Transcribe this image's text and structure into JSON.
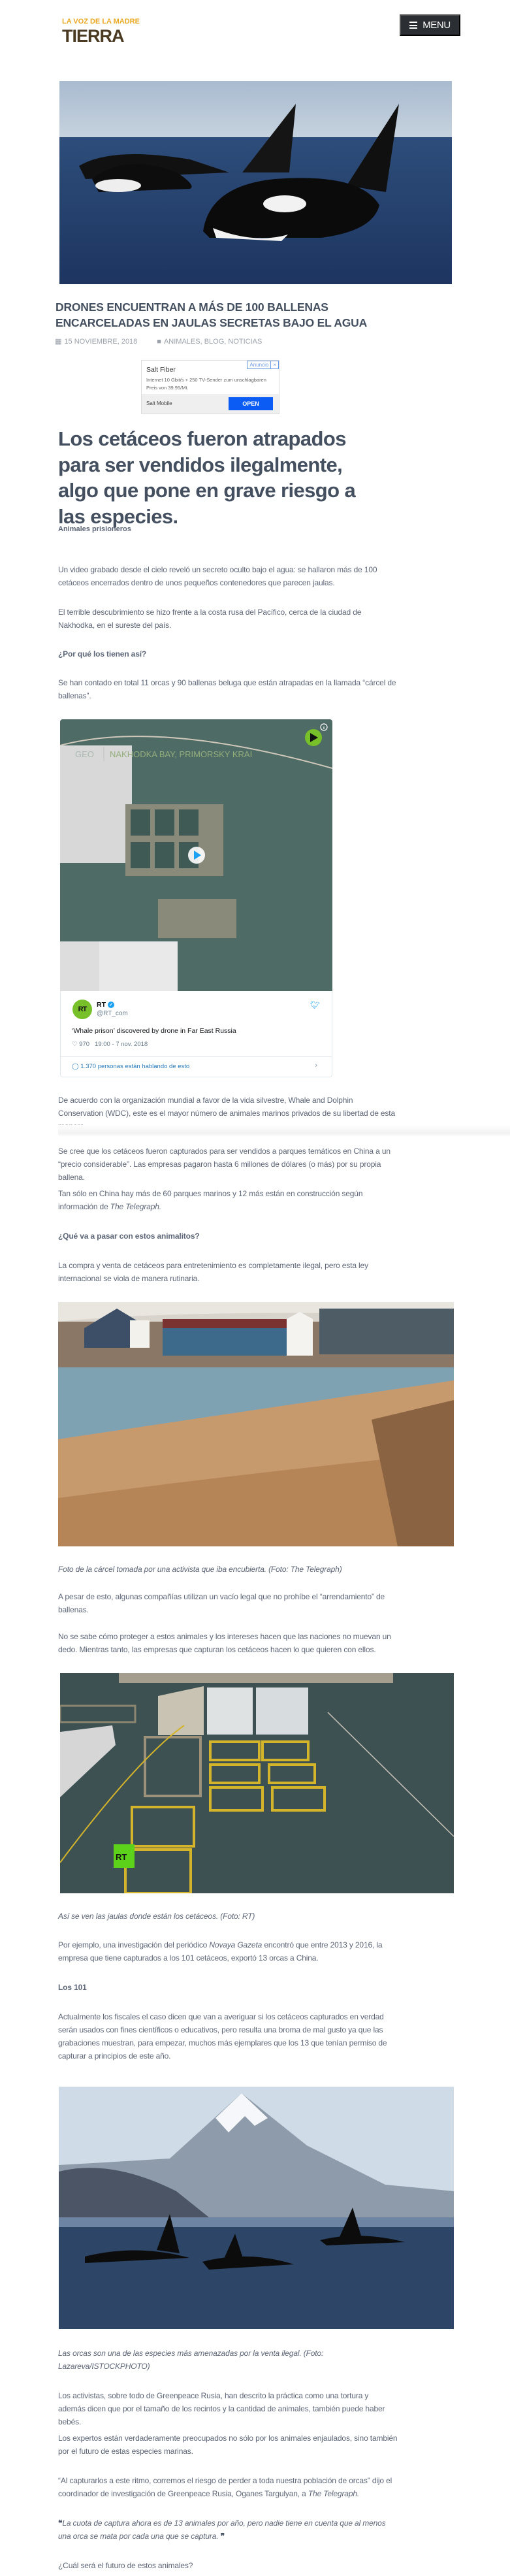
{
  "header": {
    "logo_text_top": "LA VOZ DE LA MADRE",
    "logo_text_main": "TIERRA",
    "menu_label": "MENU",
    "menu_icon": "hamburger-icon"
  },
  "colors": {
    "heading": "#444f5f",
    "body_text": "#5d6677",
    "menu_bg": "#2b2f33",
    "ad_button": "#0a5cf5",
    "twitter_blue": "#1da1f2",
    "rt_green": "#78c02a"
  },
  "article": {
    "title": "DRONES ENCUENTRAN A MÁS DE 100 BALLENAS ENCARCELADAS EN JAULAS SECRETAS BAJO EL AGUA",
    "date": "15 NOVIEMBRE, 2018",
    "categories": "ANIMALES, BLOG, NOTICIAS",
    "lead": "Los cetáceos fueron atrapados para ser vendidos ilegalmente, algo que pone en grave riesgo a las especies.",
    "kicker": "Animales prisioneros",
    "p1": "Un video grabado desde el cielo reveló un secreto oculto bajo el agua: se hallaron más de 100 cetáceos encerrados dentro de unos pequeños contenedores que parecen jaulas.",
    "p2": "El terrible descubrimiento se hizo frente a la costa rusa del Pacífico, cerca de la ciudad de Nakhodka, en el sureste del país.",
    "h1": "¿Por qué los tienen así?",
    "p3": "Se han contado en total 11 orcas y 90 ballenas beluga que están atrapadas en la llamada “cárcel de ballenas”.",
    "p4": "De acuerdo con la organización mundial a favor de la vida silvestre, Whale and Dolphin Conservation (WDC), este es el mayor número de animales marinos privados de su libertad de esta manera.",
    "p5": "Se cree que los cetáceos fueron capturados para ser vendidos a parques temáticos en China a un “precio considerable”. Las empresas pagaron hasta 6 millones de dólares (o más) por su propia ballena.",
    "p6_pre": "Tan sólo en China hay más de 60 parques marinos y 12 más están en construcción según información de ",
    "p6_em": "The Telegraph.",
    "h2": "¿Qué va a pasar con estos animalitos?",
    "p7": "La compra y venta de cetáceos para entretenimiento es completamente ilegal, pero esta ley internacional se viola de manera rutinaria.",
    "cap1": "Foto de la cárcel tomada por una activista que iba encubierta. (Foto: The Telegraph)",
    "p8": "A pesar de esto, algunas compañías utilizan un vacío legal que no prohíbe el “arrendamiento” de ballenas.",
    "p9": "No se sabe cómo proteger a estos animales y los intereses hacen que las naciones no muevan un dedo. Mientras tanto, las empresas que capturan los cetáceos hacen lo que quieren con ellos.",
    "cap2": "Así se ven las jaulas donde están los cetáceos. (Foto: RT)",
    "p10_pre": "Por ejemplo, una investigación del periódico ",
    "p10_em": "Novaya Gazeta",
    "p10_post": " encontró que entre 2013 y 2016, la empresa que tiene capturados a los 101 cetáceos, exportó 13 orcas a China.",
    "h3": "Los 101",
    "p11": "Actualmente los fiscales el caso dicen que van a averiguar si los cetáceos capturados en verdad serán usados con fines científicos o educativos, pero resulta una broma de mal gusto ya que las grabaciones muestran, para empezar, muchos más ejemplares que los 13 que tenían permiso de capturar a principios de este año.",
    "cap3": "Las orcas son una de las especies más amenazadas por la venta ilegal. (Foto: Lazareva/ISTOCKPHOTO)",
    "p12": "Los activistas, sobre todo de Greenpeace Rusia, han descrito la práctica como una tortura y además dicen que por el tamaño de los recintos y la cantidad de animales, también puede haber bebés.",
    "p13": "Los expertos están verdaderamente preocupados no sólo por los animales enjaulados, sino también por el futuro de estas especies marinas.",
    "p14_pre": "“Al capturarlos a este ritmo, corremos el riesgo de perder a toda nuestra población de orcas” dijo el coordinador de investigación de Greenpeace Rusia, Oganes Targulyan, a ",
    "p14_em": "The Telegraph.",
    "quote_open": "❝",
    "quote": "La cuota de captura ahora es de 13 animales por año, pero nadie tiene en cuenta que al menos una orca se mata por cada una que se captura.",
    "quote_close": "❞",
    "p15": "¿Cuál será el futuro de estos animales?"
  },
  "ad": {
    "tag": "Anuncio",
    "close": "×",
    "headline": "Salt Fiber",
    "description": "Internet 10 Gbit/s + 250 TV-Sender zum unschlagbaren Preis von 39.95/Mt.",
    "advertiser": "Salt Mobile",
    "cta": "OPEN"
  },
  "tweet": {
    "video_overlay_geo": "GEO",
    "video_overlay_place": "NAKHODKA BAY, PRIMORSKY KRAI",
    "avatar_text": "RT",
    "name": "RT",
    "handle": "@RT_com",
    "text": "‘Whale prison’ discovered by drone in Far East Russia",
    "likes": "970",
    "timestamp": "19:00 - 7 nov. 2018",
    "talking": "1.370 personas están hablando de esto"
  },
  "images": {
    "cages_watermark": "RT"
  }
}
